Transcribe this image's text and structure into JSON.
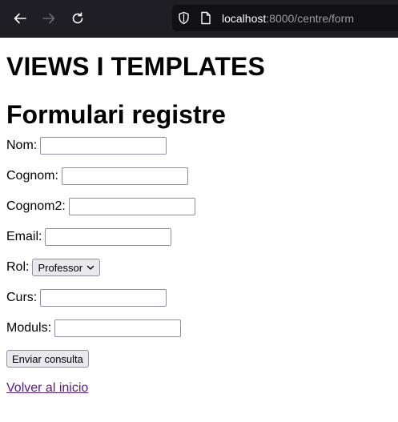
{
  "browser": {
    "url_host": "localhost",
    "url_rest": ":8000/centre/form"
  },
  "page": {
    "site_title": "VIEWS I TEMPLATES",
    "form_title": "Formulari registre"
  },
  "form": {
    "fields": [
      {
        "label": "Nom:",
        "value": ""
      },
      {
        "label": "Cognom:",
        "value": ""
      },
      {
        "label": "Cognom2:",
        "value": ""
      },
      {
        "label": "Email:",
        "value": ""
      }
    ],
    "rol": {
      "label": "Rol:",
      "selected": "Professor"
    },
    "fields2": [
      {
        "label": "Curs:",
        "value": ""
      },
      {
        "label": "Moduls:",
        "value": ""
      }
    ],
    "submit_label": "Enviar consulta"
  },
  "link": {
    "label": "Volver al inicio"
  },
  "icons": {
    "back": "arrow-left-icon",
    "forward": "arrow-right-icon",
    "reload": "reload-icon",
    "shield": "shield-icon",
    "page": "page-icon",
    "select_arrow": "chevron-down-icon"
  },
  "colors": {
    "toolbar_bg": "#1f1e25",
    "urlbar_bg": "#101015",
    "visited_link": "#551a8b"
  }
}
